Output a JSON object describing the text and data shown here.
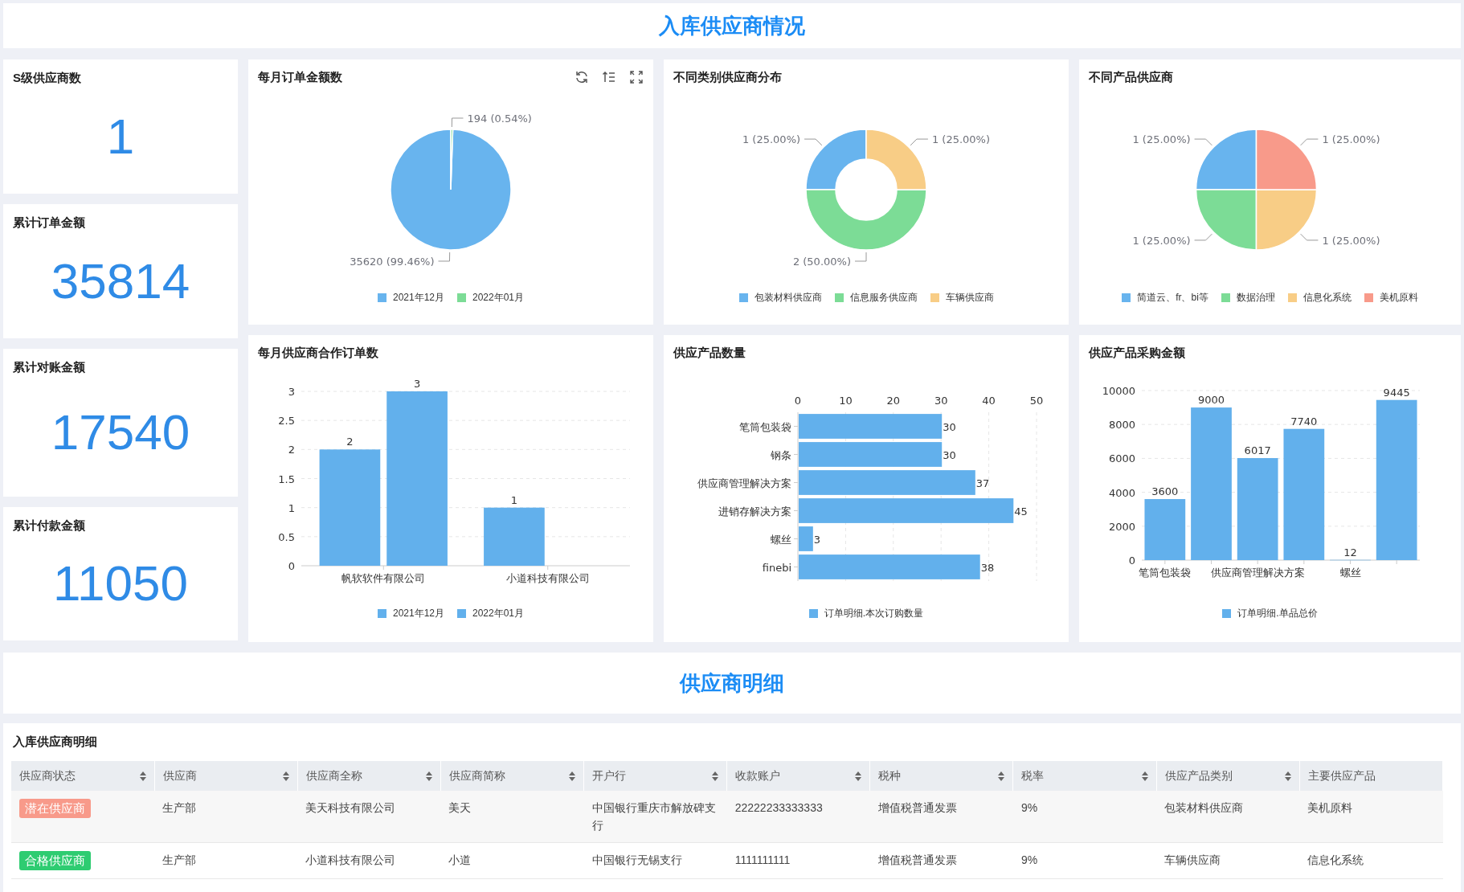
{
  "header": {
    "title": "入库供应商情况"
  },
  "kpis": [
    {
      "label": "S级供应商数",
      "value": "1"
    },
    {
      "label": "累计订单金额",
      "value": "35814"
    },
    {
      "label": "累计对账金额",
      "value": "17540"
    },
    {
      "label": "累计付款金额",
      "value": "11050"
    }
  ],
  "charts": [
    {
      "title": "每月订单金额数",
      "chart_data": {
        "type": "pie",
        "categories": [
          "2021年12月",
          "2022年01月"
        ],
        "values": [
          35620,
          194
        ],
        "colors": [
          "#68b4ee",
          "#7cdc96"
        ],
        "value_labels": [
          "35620 (99.46%)",
          "194 (0.54%)"
        ]
      }
    },
    {
      "title": "不同类别供应商分布",
      "chart_data": {
        "type": "donut",
        "categories": [
          "包装材料供应商",
          "信息服务供应商",
          "车辆供应商"
        ],
        "values": [
          1,
          2,
          1
        ],
        "colors": [
          "#68b4ee",
          "#7cdc96",
          "#f8cd86"
        ],
        "value_labels": [
          "1 (25.00%)",
          "2 (50.00%)",
          "1 (25.00%)"
        ]
      }
    },
    {
      "title": "不同产品供应商",
      "chart_data": {
        "type": "pie",
        "categories": [
          "简道云、fr、bi等",
          "数据治理",
          "信息化系统",
          "美机原料"
        ],
        "values": [
          1,
          1,
          1,
          1
        ],
        "colors": [
          "#68b4ee",
          "#7cdc96",
          "#f8cd86",
          "#f89a8a"
        ],
        "value_labels": [
          "1 (25.00%)",
          "1 (25.00%)",
          "1 (25.00%)",
          "1 (25.00%)"
        ]
      }
    },
    {
      "title": "每月供应商合作订单数",
      "chart_data": {
        "type": "bar",
        "categories": [
          "帆软软件有限公司",
          "小道科技有限公司"
        ],
        "series": [
          {
            "name": "2021年12月",
            "color": "#62b0ec",
            "values": [
              2,
              1
            ]
          },
          {
            "name": "2022年01月",
            "color": "#62b0ec",
            "values": [
              3,
              null
            ]
          }
        ],
        "ylim": [
          0,
          3
        ],
        "yticks": [
          0,
          0.5,
          1,
          1.5,
          2,
          2.5,
          3
        ],
        "grid": true,
        "data_labels": true
      }
    },
    {
      "title": "供应产品数量",
      "chart_data": {
        "type": "bar",
        "orientation": "horizontal",
        "categories": [
          "笔筒包装袋",
          "钢条",
          "供应商管理解决方案",
          "进销存解决方案",
          "螺丝",
          "finebi"
        ],
        "series": [
          {
            "name": "订单明细.本次订购数量",
            "color": "#62b0ec",
            "values": [
              30,
              30,
              37,
              45,
              3,
              38
            ]
          }
        ],
        "xlim": [
          0,
          50
        ],
        "xticks": [
          0,
          10,
          20,
          30,
          40,
          50
        ],
        "grid": true,
        "data_labels": true
      }
    },
    {
      "title": "供应产品采购金额",
      "chart_data": {
        "type": "bar",
        "categories": [
          "笔筒包装袋",
          null,
          "供应商管理解决方案",
          null,
          "螺丝",
          null
        ],
        "series": [
          {
            "name": "订单明细.单品总价",
            "color": "#62b0ec",
            "values": [
              3600,
              9000,
              6017,
              7740,
              12,
              9445
            ]
          }
        ],
        "ylim": [
          0,
          10000
        ],
        "yticks": [
          0,
          2000,
          4000,
          6000,
          8000,
          10000
        ],
        "grid": true,
        "data_labels": true
      }
    }
  ],
  "section": {
    "title": "供应商明细"
  },
  "table": {
    "title": "入库供应商明细",
    "columns": [
      {
        "label": "供应商状态",
        "sortable": true
      },
      {
        "label": "供应商",
        "sortable": true
      },
      {
        "label": "供应商全称",
        "sortable": true
      },
      {
        "label": "供应商简称",
        "sortable": true
      },
      {
        "label": "开户行",
        "sortable": true
      },
      {
        "label": "收款账户",
        "sortable": true
      },
      {
        "label": "税种",
        "sortable": true
      },
      {
        "label": "税率",
        "sortable": true
      },
      {
        "label": "供应产品类别",
        "sortable": true
      },
      {
        "label": "主要供应产品",
        "sortable": false
      }
    ],
    "rows": [
      {
        "cells": [
          {
            "kind": "badge",
            "text": "潜在供应商",
            "color": "#f89a8a"
          },
          "生产部",
          "美天科技有限公司",
          "美天",
          "中国银行重庆市解放碑支行",
          "22222233333333",
          "增值税普通发票",
          "9%",
          "包装材料供应商",
          "美机原料"
        ]
      },
      {
        "cells": [
          {
            "kind": "badge",
            "text": "合格供应商",
            "color": "#2ecc71"
          },
          "生产部",
          "小道科技有限公司",
          "小道",
          "中国银行无锡支行",
          "1111111111",
          "增值税普通发票",
          "9%",
          "车辆供应商",
          "信息化系统"
        ]
      }
    ]
  }
}
